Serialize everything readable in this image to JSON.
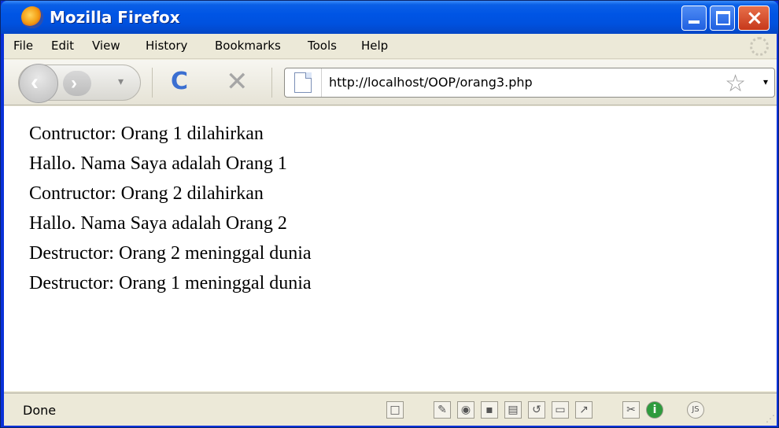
{
  "window": {
    "title": "Mozilla Firefox",
    "title_color": "#ffffff",
    "titlebar_color": "#0055e5"
  },
  "menu": {
    "items": [
      "File",
      "Edit",
      "View",
      "History",
      "Bookmarks",
      "Tools",
      "Help"
    ]
  },
  "toolbar": {
    "back_icon": "‹",
    "forward_icon": "›",
    "history_icon": "▾",
    "reload_icon": "C",
    "stop_icon": "✕"
  },
  "address": {
    "url": "http://localhost/OOP/orang3.php",
    "star_icon": "☆",
    "dropdown_icon": "▾"
  },
  "content": {
    "lines": [
      "Contructor: Orang 1 dilahirkan",
      "Hallo. Nama Saya adalah Orang 1",
      "Contructor: Orang 2 dilahirkan",
      "Hallo. Nama Saya adalah Orang 2",
      "Destructor: Orang 2 meninggal dunia",
      "Destructor: Orang 1 meninggal dunia"
    ]
  },
  "status": {
    "text": "Done",
    "icons": [
      {
        "name": "page-icon",
        "glyph": "□"
      },
      {
        "name": "pencil-icon",
        "glyph": "✎"
      },
      {
        "name": "globe-icon",
        "glyph": "◉"
      },
      {
        "name": "save-icon",
        "glyph": "▪"
      },
      {
        "name": "printer-icon",
        "glyph": "▤"
      },
      {
        "name": "refresh-icon",
        "glyph": "↺"
      },
      {
        "name": "window-icon",
        "glyph": "▭"
      },
      {
        "name": "chart-icon",
        "glyph": "↗"
      },
      {
        "name": "tools-icon",
        "glyph": "✂"
      },
      {
        "name": "info-icon",
        "glyph": "i"
      },
      {
        "name": "js-icon",
        "glyph": "JS"
      }
    ]
  }
}
